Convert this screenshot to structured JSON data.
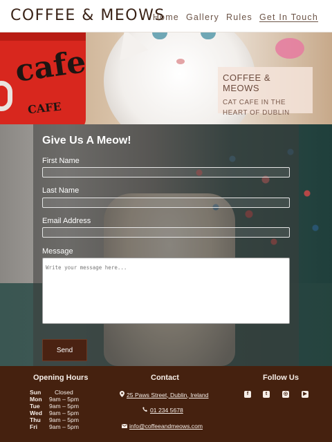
{
  "brand": "COFFEE & MEOWS",
  "nav": [
    {
      "label": "Home"
    },
    {
      "label": "Gallery"
    },
    {
      "label": "Rules"
    },
    {
      "label": "Get In Touch",
      "active": true
    }
  ],
  "hero": {
    "cup_text": "cafe",
    "cup_text2": "CAFE",
    "card_title": "COFFEE & MEOWS",
    "card_subtitle": "CAT CAFE IN THE HEART OF DUBLIN"
  },
  "form": {
    "title": "Give Us A Meow!",
    "first_name_label": "First Name",
    "last_name_label": "Last Name",
    "email_label": "Email Address",
    "message_label": "Message",
    "message_placeholder": "Write your message here...",
    "send_label": "Send"
  },
  "footer": {
    "hours_title": "Opening Hours",
    "hours": [
      {
        "day": "Sun",
        "time": "Closed"
      },
      {
        "day": "Mon",
        "time": "9am – 5pm"
      },
      {
        "day": "Tue",
        "time": "9am – 5pm"
      },
      {
        "day": "Wed",
        "time": "9am – 5pm"
      },
      {
        "day": "Thu",
        "time": "9am – 5pm"
      },
      {
        "day": "Fri",
        "time": "9am – 5pm"
      }
    ],
    "contact_title": "Contact",
    "address": "25 Paws Street, Dublin, Ireland",
    "phone": "01 234 5678",
    "email": "info@coffeeandmeows.com",
    "follow_title": "Follow Us",
    "social": [
      "facebook-icon",
      "twitter-icon",
      "instagram-icon",
      "youtube-icon"
    ]
  },
  "colors": {
    "brand_brown": "#3a2317",
    "footer_bg": "#45210f",
    "button_bg": "#4a2212"
  }
}
